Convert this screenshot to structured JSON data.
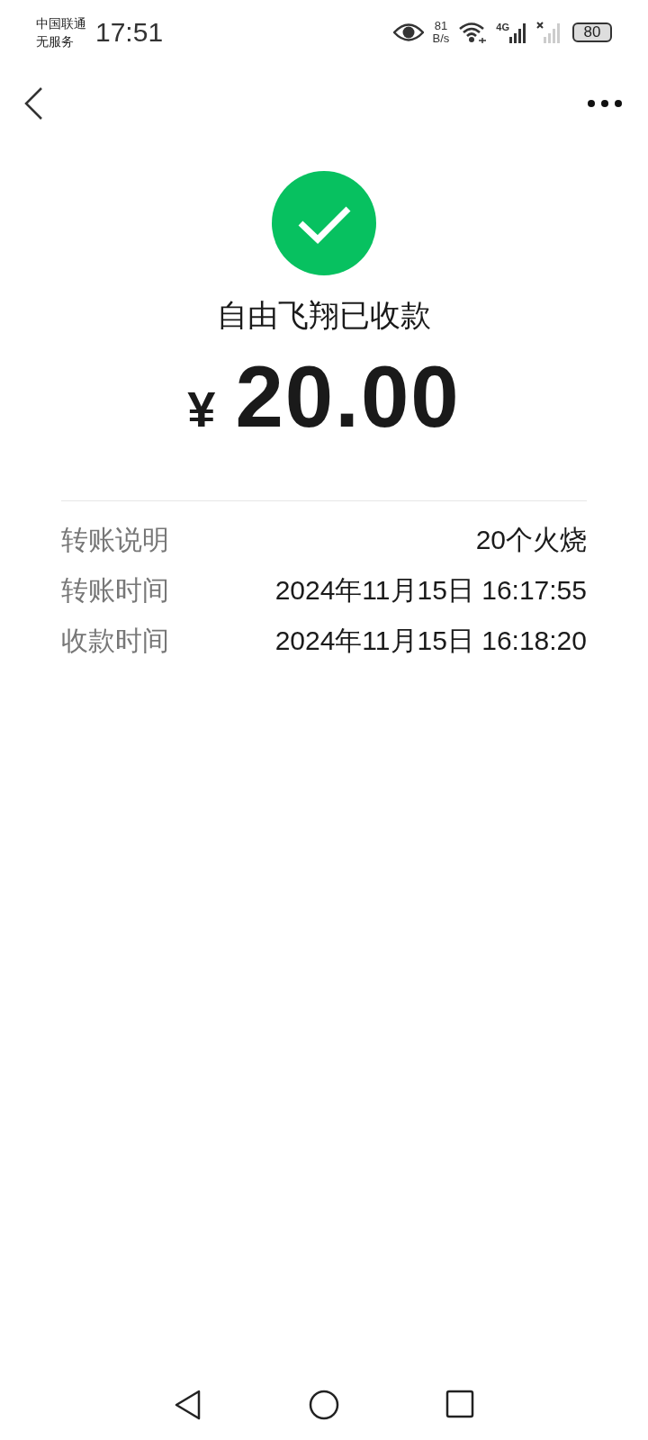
{
  "status_bar": {
    "carrier": "中国联通",
    "service": "无服务",
    "time": "17:51",
    "speed_value": "81",
    "speed_unit": "B/s",
    "network": "4G",
    "battery": "80"
  },
  "payment": {
    "title": "自由飞翔已收款",
    "currency": "¥",
    "amount": "20.00"
  },
  "details": [
    {
      "label": "转账说明",
      "value": "20个火烧"
    },
    {
      "label": "转账时间",
      "value": "2024年11月15日 16:17:55"
    },
    {
      "label": "收款时间",
      "value": "2024年11月15日 16:18:20"
    }
  ]
}
